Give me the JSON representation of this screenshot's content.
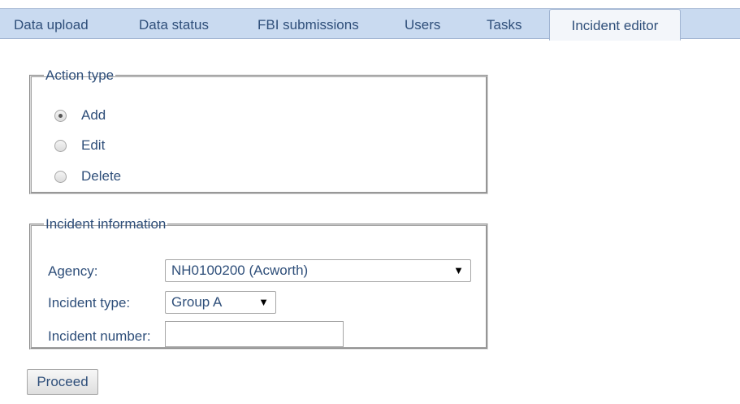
{
  "tabs": [
    {
      "label": "Data upload"
    },
    {
      "label": "Data status"
    },
    {
      "label": "FBI submissions"
    },
    {
      "label": "Users"
    },
    {
      "label": "Tasks"
    },
    {
      "label": "Incident editor",
      "active": true
    }
  ],
  "action_type": {
    "legend": "Action type",
    "options": [
      {
        "label": "Add",
        "checked": true
      },
      {
        "label": "Edit",
        "checked": false
      },
      {
        "label": "Delete",
        "checked": false
      }
    ]
  },
  "incident_info": {
    "legend": "Incident information",
    "agency_label": "Agency:",
    "agency_value": "NH0100200 (Acworth)",
    "incident_type_label": "Incident type:",
    "incident_type_value": "Group A",
    "incident_number_label": "Incident number:",
    "incident_number_value": ""
  },
  "proceed_label": "Proceed",
  "colors": {
    "tabbar_bg": "#c9daf0",
    "text_blue": "#2f4f7a"
  }
}
